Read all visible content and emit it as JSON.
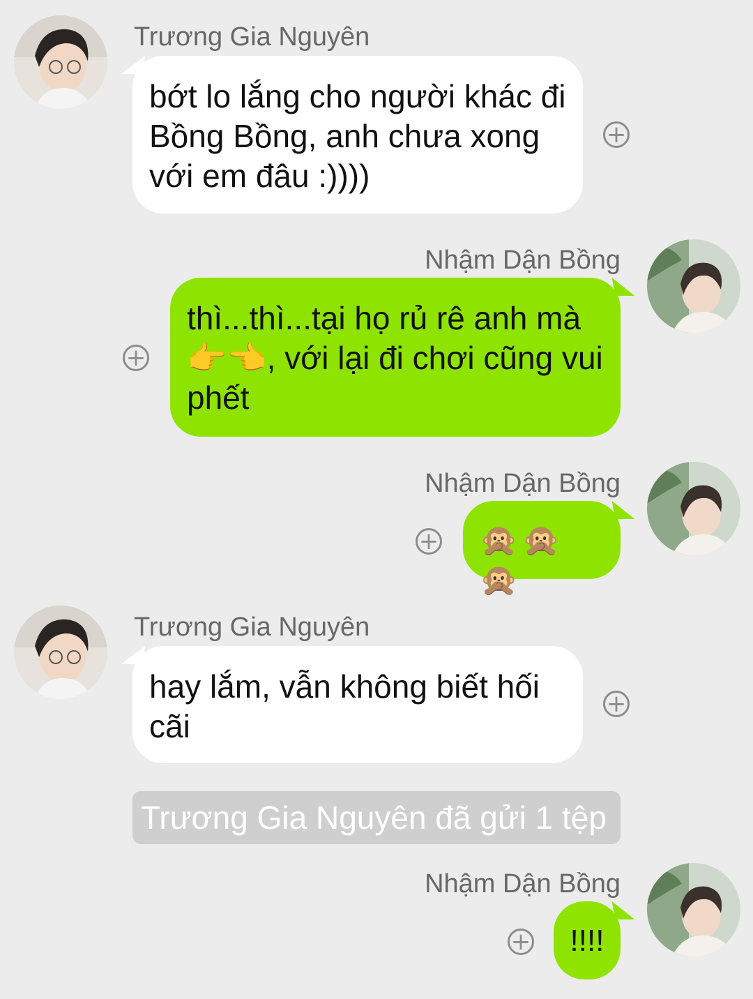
{
  "messages": [
    {
      "sender": "Trương Gia Nguyên",
      "text": "bớt lo lắng cho người khác đi Bồng Bồng, anh chưa xong với em đâu :))))"
    },
    {
      "sender": "Nhậm Dận Bồng",
      "text_parts": [
        "thì...thì...tại họ rủ rê anh mà ",
        "👉👈",
        ", với lại đi chơi cũng vui phết"
      ]
    },
    {
      "sender": "Nhậm Dận Bồng",
      "text": "🙊🙊🙊"
    },
    {
      "sender": "Trương Gia Nguyên",
      "text": "hay lắm, vẫn không biết hối cãi"
    },
    {
      "system": "Trương Gia Nguyên đã gửi 1 tệp"
    },
    {
      "sender": "Nhậm Dận Bồng",
      "text": "!!!!"
    }
  ],
  "icons": {
    "plus": "plus-circle-icon",
    "plus_glyph": "+"
  },
  "colors": {
    "background": "#ececec",
    "incoming_bubble": "#ffffff",
    "outgoing_bubble": "#8ee400",
    "system_pill": "#cfcfcf"
  }
}
